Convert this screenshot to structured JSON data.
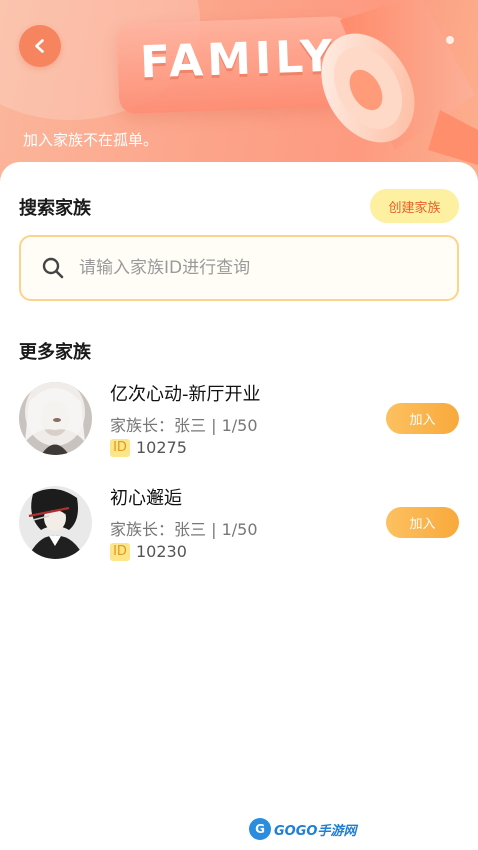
{
  "hero": {
    "banner_word": "FAMILY",
    "caption": "加入家族不在孤单。"
  },
  "search_section": {
    "title": "搜索家族",
    "create_label": "创建家族",
    "placeholder": "请输入家族ID进行查询"
  },
  "more_section": {
    "title": "更多家族"
  },
  "families": [
    {
      "name": "亿次心动-新厅开业",
      "meta": "家族长：张三 | 1/50",
      "id_badge": "ID",
      "id": "10275",
      "join_label": "加入"
    },
    {
      "name": "初心邂逅",
      "meta": "家族长：张三 | 1/50",
      "id_badge": "ID",
      "id": "10230",
      "join_label": "加入"
    }
  ],
  "watermark": {
    "logo": "G",
    "text": "GOGO手游网"
  },
  "colors": {
    "accent_orange": "#f8a93c",
    "create_bg": "#fdf0a0",
    "create_text": "#e9612d",
    "search_border": "#fcd38a"
  },
  "icons": [
    "back-arrow-icon",
    "search-icon",
    "megaphone-icon",
    "id-badge-icon"
  ]
}
